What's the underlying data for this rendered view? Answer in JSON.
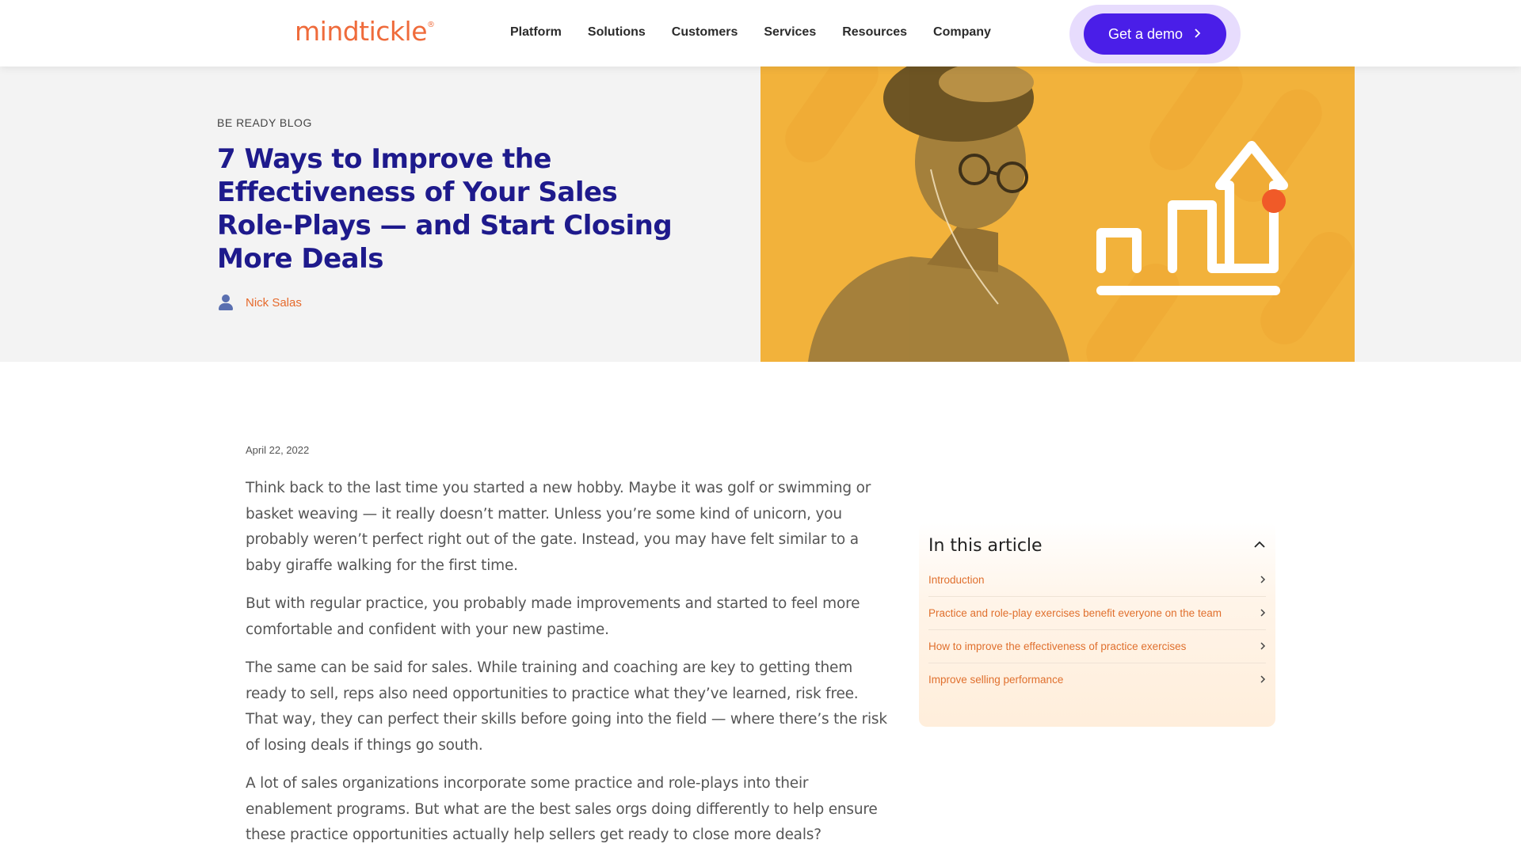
{
  "header": {
    "logo": "mindtickle",
    "logo_mark": "®",
    "nav": [
      "Platform",
      "Solutions",
      "Customers",
      "Services",
      "Resources",
      "Company"
    ],
    "cta_label": "Get a demo"
  },
  "hero": {
    "eyebrow": "BE READY BLOG",
    "title": "7 Ways to Improve the Effectiveness of Your Sales Role-Plays — and Start Closing More Deals",
    "author": "Nick Salas"
  },
  "article": {
    "date": "April 22, 2022",
    "paragraphs": [
      "Think back to the last time you started a new hobby. Maybe it was golf or swimming or basket weaving — it really doesn’t matter. Unless you’re some kind of unicorn, you probably weren’t perfect right out of the gate. Instead, you may have felt similar to a baby giraffe walking for the first time.",
      "But with regular practice, you probably made improvements and started to feel more comfortable and confident with your new pastime.",
      "The same can be said for sales. While training and coaching are key to getting them ready to sell, reps also need opportunities to practice what they’ve learned, risk free. That way, they can perfect their skills before going into the field — where there’s the risk of losing deals if things go south.",
      "A lot of sales organizations incorporate some practice and role-plays into their enablement programs. But what are the best sales orgs doing differently to help ensure these practice opportunities actually help sellers get ready to close more deals?"
    ]
  },
  "toc": {
    "title": "In this article",
    "items": [
      "Introduction",
      "Practice and role-play exercises benefit everyone on the team",
      "How to improve the effectiveness of practice exercises",
      "Improve selling performance"
    ]
  },
  "colors": {
    "brand_orange": "#ef6b3b",
    "title_navy": "#1e1a8c",
    "cta_purple": "#4a1ee8",
    "hero_yellow": "#f2b23b"
  }
}
